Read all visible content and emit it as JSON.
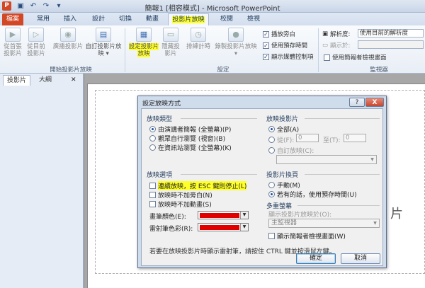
{
  "window": {
    "title": "簡報1 [相容模式] - Microsoft PowerPoint",
    "app_icon": "P"
  },
  "quick_access": [
    "save-icon",
    "undo-icon",
    "redo-icon",
    "customize-icon"
  ],
  "tabs": [
    {
      "label": "檔案",
      "kind": "file"
    },
    {
      "label": "常用"
    },
    {
      "label": "插入"
    },
    {
      "label": "設計"
    },
    {
      "label": "切換"
    },
    {
      "label": "動畫"
    },
    {
      "label": "投影片放映",
      "active": true
    },
    {
      "label": "校閱"
    },
    {
      "label": "檢視"
    }
  ],
  "ribbon": {
    "group_start": {
      "label": "開始投影片放映",
      "buttons": [
        "從首張投影片",
        "從目前投影片",
        "廣播投影片",
        "自訂投影片放映 ▾"
      ]
    },
    "group_setup": {
      "label": "設定",
      "setup_button": "設定投影片放映",
      "hide_button": "隱藏投影片",
      "rehearse_button": "排練計時",
      "record_button": "錄製投影片放映 ▾",
      "checkboxes": [
        "播放旁白",
        "使用預存時間",
        "顯示媒體控制項"
      ]
    },
    "group_monitors": {
      "label": "監視器",
      "resolution_label": "解析度:",
      "resolution_value": "使用目前的解析度",
      "show_on_label": "顯示於:",
      "presenter_view": "使用簡報者檢視畫面"
    }
  },
  "slide_panel": {
    "tabs": [
      "投影片",
      "大綱"
    ]
  },
  "slide_text": "片",
  "dialog": {
    "title": "設定放映方式",
    "help": "?",
    "close": "X",
    "show_type": {
      "title": "放映類型",
      "options": [
        "由演講者簡報 (全螢幕)(P)",
        "觀眾自行瀏覽 (視窗)(B)",
        "在資訊站瀏覽 (全螢幕)(K)"
      ]
    },
    "show_slides": {
      "title": "放映投影片",
      "all": "全部(A)",
      "from": "從(F):",
      "from_value": "0",
      "to": "至(T):",
      "to_value": "0",
      "custom": "自訂放映(C):"
    },
    "show_options": {
      "title": "放映選項",
      "loop": "連續放映，按 ESC 鍵則停止(L)",
      "no_narration": "放映時不加旁白(N)",
      "no_animation": "放映時不加動畫(S)",
      "pen_color": "畫筆顏色(E):",
      "laser_color": "雷射筆色彩(R):",
      "pen_color_hex": "#e00000",
      "laser_color_hex": "#e00000"
    },
    "advance": {
      "title": "投影片換頁",
      "manual": "手動(M)",
      "timings": "若有的話，使用預存時間(U)"
    },
    "multiple_monitors": {
      "title": "多重螢幕",
      "show_on_label": "顯示投影片放映於(O):",
      "show_on_value": "主監視器",
      "presenter_view": "顯示簡報者檢視畫面(W)"
    },
    "footnote": "若要在放映投影片時顯示雷射筆，請按住 CTRL 鍵並按滑鼠左鍵。",
    "ok": "確定",
    "cancel": "取消"
  }
}
